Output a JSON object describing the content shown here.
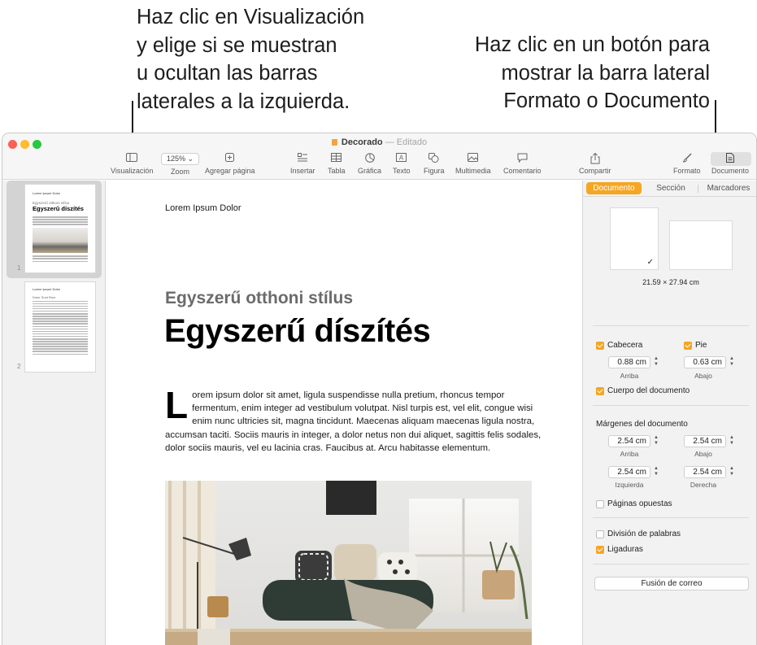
{
  "callouts": {
    "left": [
      "Haz clic en Visualización",
      "y elige si se muestran",
      "u ocultan las barras",
      "laterales a la izquierda."
    ],
    "right": [
      "Haz clic en un botón para",
      "mostrar la barra lateral",
      "Formato o Documento"
    ]
  },
  "window": {
    "title": "Decorado",
    "separator": "—",
    "status": "Editado"
  },
  "toolbar": {
    "view": "Visualización",
    "zoom_value": "125%",
    "zoom": "Zoom",
    "add_page": "Agregar página",
    "insert": "Insertar",
    "table": "Tabla",
    "chart": "Gráfica",
    "text": "Texto",
    "shape": "Figura",
    "media": "Multimedia",
    "comment": "Comentario",
    "share": "Compartir",
    "format": "Formato",
    "document": "Documento"
  },
  "thumbnails": {
    "pages": [
      "1",
      "2"
    ],
    "page1_subtitle": "Egyszerű otthoni stílus",
    "page1_heading": "Egyszerű díszítés",
    "page2_heading": "Dolor Sunt Rum"
  },
  "page": {
    "header": "Lorem Ipsum Dolor",
    "subtitle": "Egyszerű otthoni stílus",
    "heading": "Egyszerű díszítés",
    "dropcap": "L",
    "body": "orem ipsum dolor sit amet, ligula suspendisse nulla pretium, rhoncus tempor fermentum, enim integer ad vestibulum volutpat. Nisl turpis est, vel elit, congue wisi enim nunc ultricies sit, magna tincidunt. Maecenas aliquam maecenas ligula nostra, accumsan taciti. Sociis mauris in integer, a dolor netus non dui aliquet, sagittis felis sodales, dolor sociis mauris, vel eu lacinia cras. Faucibus at. Arcu habitasse elementum."
  },
  "inspector": {
    "tabs": [
      "Documento",
      "Sección",
      "Marcadores"
    ],
    "active_tab": "Documento",
    "paper_size": "21.59 × 27.94 cm",
    "header_label": "Cabecera",
    "footer_label": "Pie",
    "header_value": "0.88 cm",
    "footer_value": "0.63 cm",
    "header_sub": "Arriba",
    "footer_sub": "Abajo",
    "body_label": "Cuerpo del documento",
    "margins_title": "Márgenes del documento",
    "margin_top": "2.54 cm",
    "margin_bottom": "2.54 cm",
    "margin_left": "2.54 cm",
    "margin_right": "2.54 cm",
    "margin_top_label": "Arriba",
    "margin_bottom_label": "Abajo",
    "margin_left_label": "Izquierda",
    "margin_right_label": "Derecha",
    "facing_pages": "Páginas opuestas",
    "hyphenation": "División de palabras",
    "ligatures": "Ligaduras",
    "mail_merge": "Fusión de correo"
  },
  "colors": {
    "accent": "#f5a623",
    "close": "#fe5f57",
    "minimize": "#febc2e",
    "maximize": "#28c840"
  }
}
